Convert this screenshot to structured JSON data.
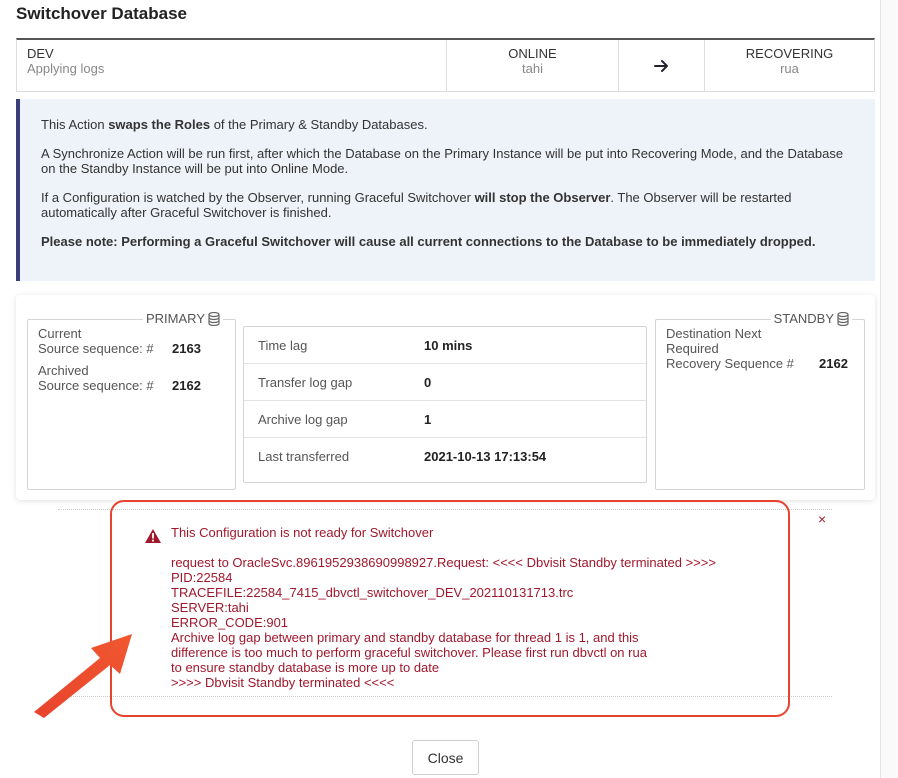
{
  "dialog": {
    "title": "Switchover Database",
    "close_label": "Close"
  },
  "status": {
    "source_name": "DEV",
    "source_state": "Applying logs",
    "primary_state": "ONLINE",
    "primary_host": "tahi",
    "standby_state": "RECOVERING",
    "standby_host": "rua"
  },
  "info": {
    "p1_pre": "This Action ",
    "p1_bold": "swaps the Roles",
    "p1_post": " of the Primary & Standby Databases.",
    "p2": "A Synchronize Action will be run first, after which the Database on the Primary Instance will be put into Recovering Mode, and the Database on the Standby Instance will be put into Online Mode.",
    "p3_pre": "If a Configuration is watched by the Observer, running Graceful Switchover ",
    "p3_bold": "will stop the Observer",
    "p3_post": ". The Observer will be restarted automatically after Graceful Switchover is finished.",
    "p4": "Please note: Performing a Graceful Switchover will cause all current connections to the Database to be immediately dropped."
  },
  "primary": {
    "legend": "PRIMARY",
    "current_label_1": "Current",
    "current_label_2": "Source sequence: #",
    "current_value": "2163",
    "archived_label_1": "Archived",
    "archived_label_2": "Source sequence: #",
    "archived_value": "2162"
  },
  "metrics": [
    {
      "label": "Time lag",
      "value": "10 mins"
    },
    {
      "label": "Transfer log gap",
      "value": "0"
    },
    {
      "label": "Archive log gap",
      "value": "1"
    },
    {
      "label": "Last transferred",
      "value": "2021-10-13 17:13:54"
    }
  ],
  "standby": {
    "legend": "STANDBY",
    "label_1": "Destination Next",
    "label_2": "Required",
    "label_3": "Recovery Sequence #",
    "value": "2162"
  },
  "error": {
    "title": "This Configuration is not ready for Switchover",
    "close_glyph": "×",
    "lines": [
      "request to OracleSvc.8961952938690998927.Request: <<<< Dbvisit Standby terminated >>>>",
      "PID:22584",
      "TRACEFILE:22584_7415_dbvctl_switchover_DEV_202110131713.trc",
      "SERVER:tahi",
      "ERROR_CODE:901",
      "Archive log gap between primary and standby database for thread 1 is 1, and this",
      "difference is too much to perform graceful switchover. Please first run dbvctl on rua",
      "to ensure standby database is more up to date",
      ">>>> Dbvisit Standby terminated <<<<"
    ]
  },
  "colors": {
    "accent": "#3a3f7a",
    "error": "#a0182c",
    "highlight": "#e8432e",
    "info_bg": "#eef3f9"
  }
}
